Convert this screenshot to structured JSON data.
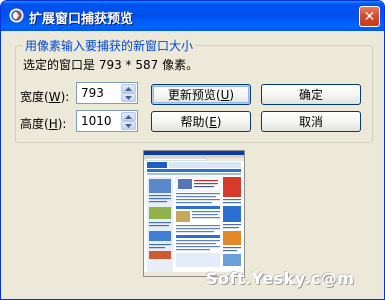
{
  "window": {
    "title": "扩展窗口捕获预览",
    "close_glyph": "✕"
  },
  "group": {
    "caption": "用像素输入要捕获的新窗口大小",
    "selected_info": "选定的窗口是 793 * 587 像素。"
  },
  "fields": {
    "width": {
      "label_prefix": "宽度(",
      "label_key": "W",
      "label_suffix": "):",
      "value": "793"
    },
    "height": {
      "label_prefix": "高度(",
      "label_key": "H",
      "label_suffix": "):",
      "value": "1010"
    }
  },
  "buttons": {
    "update_preview": {
      "prefix": "更新预览(",
      "key": "U",
      "suffix": ")"
    },
    "ok": {
      "label": "确定"
    },
    "help": {
      "prefix": "帮助(",
      "key": "E",
      "suffix": ")"
    },
    "cancel": {
      "label": "取消"
    }
  },
  "preview": {
    "headline_1": "谁能拯救千禧帝国?",
    "headline_2": "互联网上的群英会"
  },
  "watermark": "Soft.Yesky.c@m",
  "colors": {
    "titlebar": "#0053ee",
    "caption_text": "#0046d5",
    "dialog_bg": "#ece9d8"
  }
}
